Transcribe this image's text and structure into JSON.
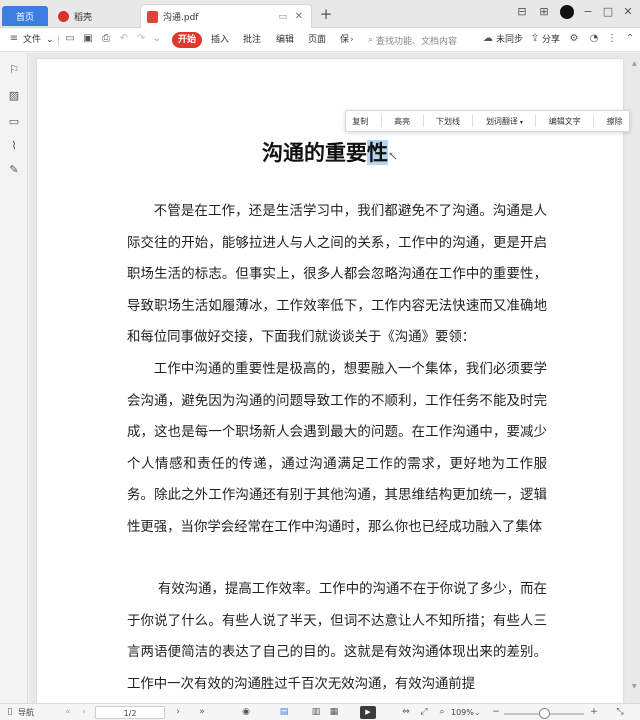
{
  "tabs": {
    "home": "首页",
    "daoke": "稻壳",
    "doc": "沟通.pdf",
    "add": "+"
  },
  "window": {
    "layout_icon": "⊟",
    "grid_icon": "⊞",
    "minimize": "−",
    "maximize": "□",
    "close": "✕"
  },
  "toolbar": {
    "menu_icon": "≡",
    "file": "文件",
    "file_arrow": "⌄",
    "start": "开始",
    "insert": "插入",
    "annotate": "批注",
    "edit": "编辑",
    "page": "页面",
    "more": "保",
    "more_arrow": "›",
    "search_placeholder": "查找功能、文档内容",
    "sync": "未同步",
    "share": "分享"
  },
  "context_menu": {
    "copy": "复制",
    "highlight": "高亮",
    "underline": "下划线",
    "translate": "划词翻译",
    "edit_text": "编辑文字",
    "erase": "擦除"
  },
  "document": {
    "title_main": "沟通的重要",
    "title_selected": "性",
    "paragraphs": [
      "不管是在工作，还是生活学习中，我们都避免不了沟通。沟通是人际交往的开始，能够拉进人与人之间的关系，工作中的沟通，更是开启职场生活的标志。但事实上，很多人都会忽略沟通在工作中的重要性，导致职场生活如履薄冰，工作效率低下，工作内容无法快速而又准确地和每位同事做好交接，下面我们就谈谈关于《沟通》要领：",
      "工作中沟通的重要性是极高的，想要融入一个集体，我们必须要学会沟通，避免因为沟通的问题导致工作的不顺利，工作任务不能及时完成，这也是每一个职场新人会遇到最大的问题。在工作沟通中，要减少个人情感和责任的传递，通过沟通满足工作的需求，更好地为工作服务。除此之外工作沟通还有别于其他沟通，其思维结构更加统一，逻辑性更强，当你学会经常在工作中沟通时，那么你也已经成功融入了集体",
      "有效沟通，提高工作效率。工作中的沟通不在于你说了多少，而在于你说了什么。有些人说了半天，但词不达意让人不知所措；有些人三言两语便简洁的表达了自己的目的。这就是有效沟通体现出来的差别。工作中一次有效的沟通胜过千百次无效沟通，有效沟通前提"
    ]
  },
  "statusbar": {
    "nav": "导航",
    "page_indicator": "1/2",
    "zoom": "109%",
    "zoom_level_fraction": 0.5
  },
  "colors": {
    "accent": "#e2372e",
    "home_tab": "#3b7de0",
    "selection": "#b8d4f5"
  }
}
